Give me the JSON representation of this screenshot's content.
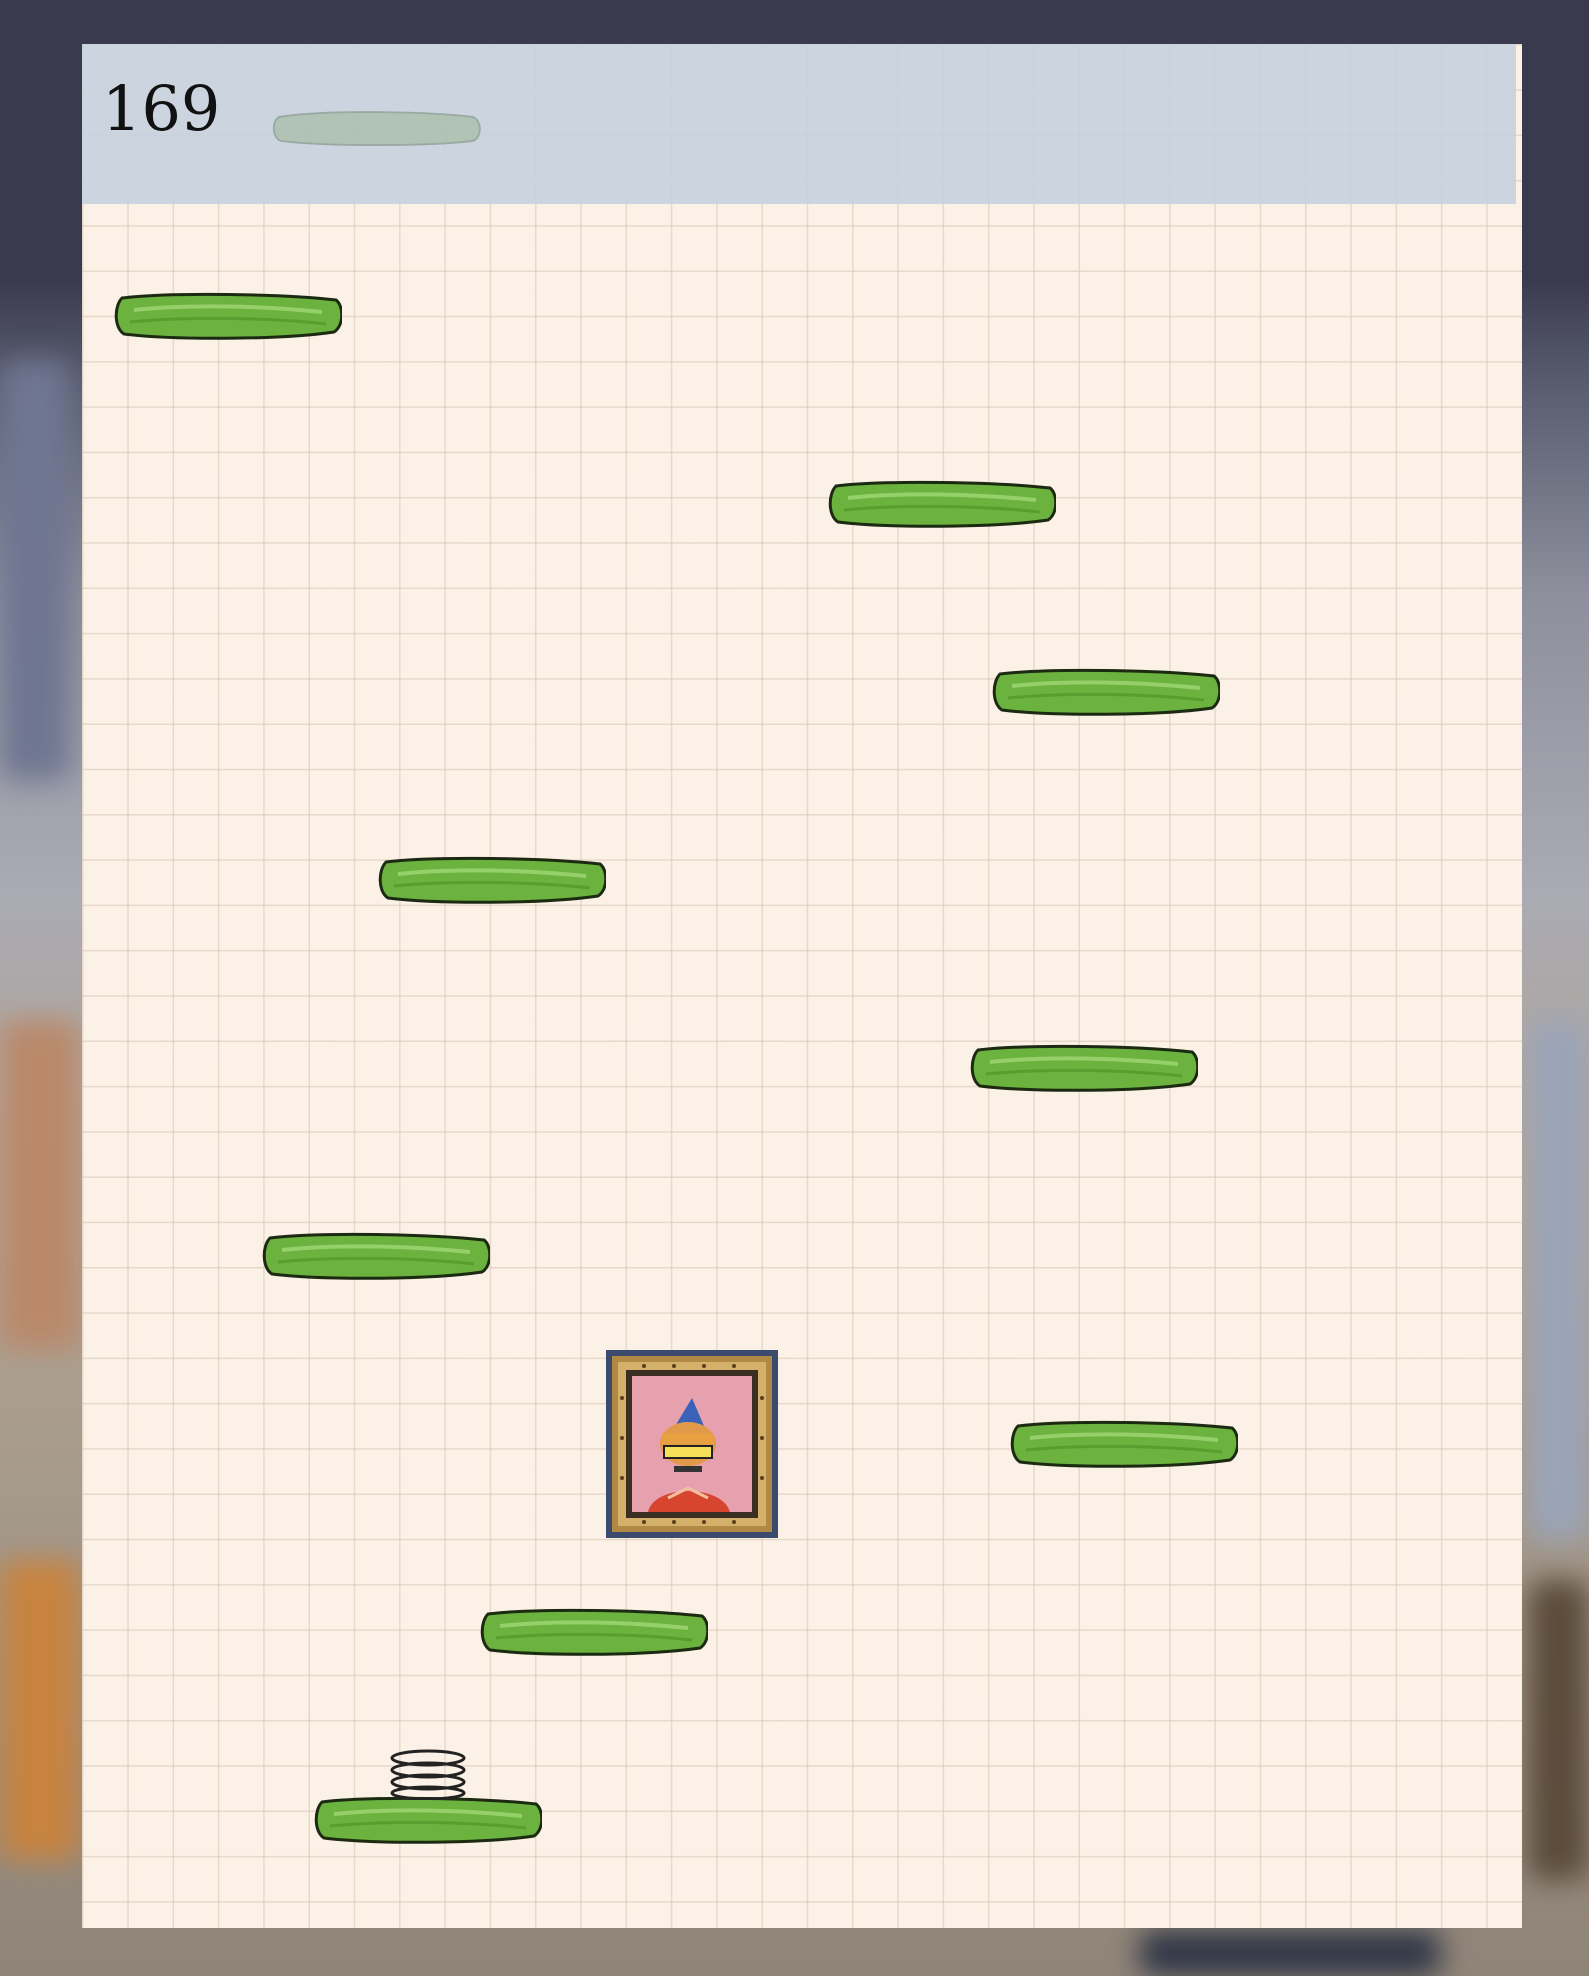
{
  "hud": {
    "score": "169"
  },
  "colors": {
    "paper": "#fbf1e6",
    "grid_line": "#d6c4b2",
    "hud_bar": "#c5d0de",
    "platform_fill": "#6bb23e",
    "platform_outline": "#1c2a12",
    "frame_gold": "#9a7b3c",
    "portrait_bg": "#e7a0ad"
  },
  "sprites": {
    "platforms": "green-platform-icon",
    "spring": "spring-icon",
    "portrait": "framed-character-portrait-icon",
    "hud_platform": "faded-platform-icon"
  },
  "counts": {
    "platforms_visible": 9,
    "springs_visible": 1
  }
}
